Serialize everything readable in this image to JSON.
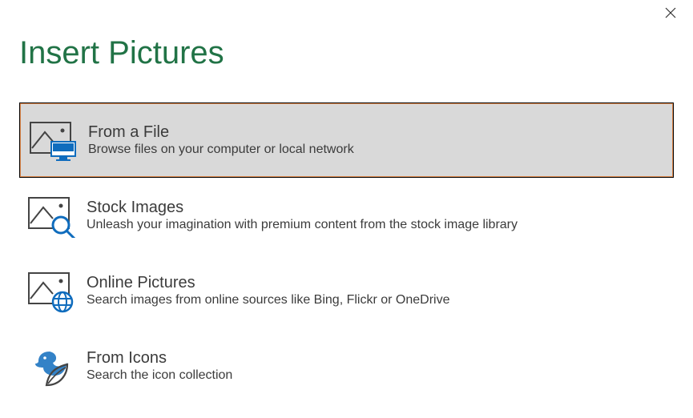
{
  "dialog": {
    "title": "Insert Pictures"
  },
  "options": [
    {
      "title": "From a File",
      "description": "Browse files on your computer or local network"
    },
    {
      "title": "Stock Images",
      "description": "Unleash your imagination with premium content from the stock image library"
    },
    {
      "title": "Online Pictures",
      "description": "Search images from online sources like Bing, Flickr or OneDrive"
    },
    {
      "title": "From Icons",
      "description": "Search the icon collection"
    }
  ]
}
